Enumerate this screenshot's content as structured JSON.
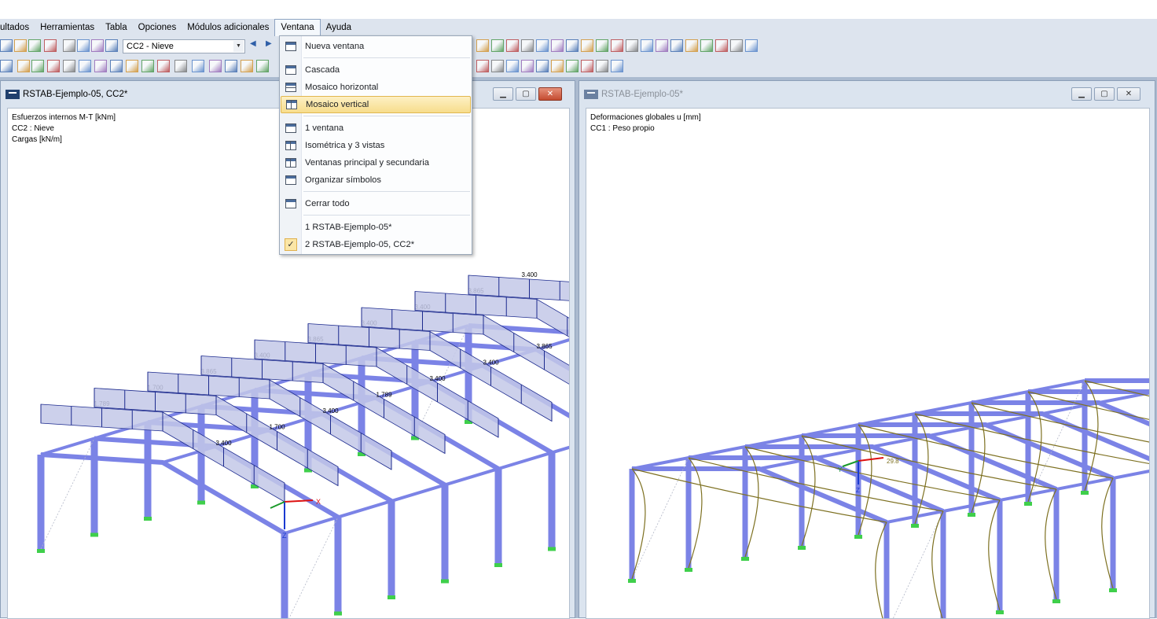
{
  "menubar": {
    "items": [
      "ultados",
      "Herramientas",
      "Tabla",
      "Opciones",
      "Módulos adicionales",
      "Ventana",
      "Ayuda"
    ],
    "open_item": "Ventana"
  },
  "toolbar": {
    "load_case_combo": "CC2 - Nieve"
  },
  "ventana_menu": {
    "items": [
      {
        "label": "Nueva ventana",
        "icon": "new-window-icon"
      },
      {
        "label": "Cascada",
        "icon": "cascade-icon"
      },
      {
        "label": "Mosaico horizontal",
        "icon": "tile-horizontal-icon"
      },
      {
        "label": "Mosaico vertical",
        "icon": "tile-vertical-icon",
        "highlighted": true
      },
      {
        "label": "1 ventana",
        "icon": "single-window-icon"
      },
      {
        "label": "Isométrica y 3 vistas",
        "icon": "isometric-views-icon"
      },
      {
        "label": "Ventanas principal y secundaria",
        "icon": "main-secondary-icon"
      },
      {
        "label": "Organizar símbolos",
        "icon": "arrange-icons-icon"
      },
      {
        "label": "Cerrar todo",
        "icon": "close-all-icon"
      },
      {
        "label": "1 RSTAB-Ejemplo-05*",
        "icon": ""
      },
      {
        "label": "2 RSTAB-Ejemplo-05, CC2*",
        "icon": "checkmark-icon",
        "checked": true
      }
    ]
  },
  "left_window": {
    "title": "RSTAB-Ejemplo-05, CC2*",
    "info": [
      "Esfuerzos internos M-T [kNm]",
      "CC2 : Nieve",
      "Cargas [kN/m]"
    ],
    "load_labels": [
      "1.789",
      "3.400",
      "1.700",
      "1.700",
      "3.865",
      "3.400",
      "3.400",
      "1.789",
      "3.865",
      "3.400",
      "3.400",
      "3.400",
      "3.400",
      "3.865",
      "3.865",
      "3.400",
      "3.400",
      "3.400",
      "3.865",
      "3.400",
      "3.400",
      "3.400",
      "3.865",
      "3.865",
      "3.400",
      "3.400",
      "3.865",
      "1.789",
      "1.700",
      "1.700",
      "3.400",
      "3.865"
    ],
    "axes": {
      "x": "X",
      "z": "Z"
    }
  },
  "right_window": {
    "title": "RSTAB-Ejemplo-05*",
    "info": [
      "Deformaciones globales u [mm]",
      "CC1 : Peso propio"
    ],
    "axes": {
      "x": "X",
      "y": "Y",
      "z": "Z"
    },
    "max_label": "29.8"
  },
  "colors": {
    "member": "#7b83e6",
    "support": "#3fcf4b",
    "load_fill": "#c3c8e8",
    "load_stroke": "#1c2a8e",
    "deformation": "#7d7020"
  }
}
